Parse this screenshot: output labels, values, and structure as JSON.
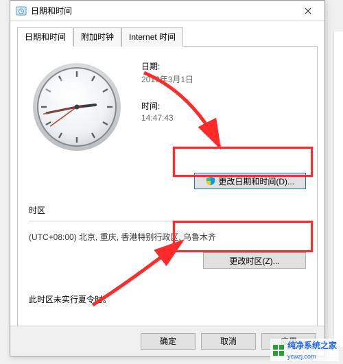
{
  "dialog": {
    "title": "日期和时间",
    "tabs": [
      {
        "label": "日期和时间"
      },
      {
        "label": "附加时钟"
      },
      {
        "label": "Internet 时间"
      }
    ],
    "dateLabel": "日期:",
    "dateValue": "2019年3月1日",
    "timeLabel": "时间:",
    "timeValue": "14:47:43",
    "changeDateTimeBtn": "更改日期和时间(D)...",
    "tzSectionLabel": "时区",
    "tzValue": "(UTC+08:00) 北京, 重庆, 香港特别行政区, 乌鲁木齐",
    "changeTzBtn": "更改时区(Z)...",
    "dstNote": "此时区未实行夏令时。",
    "okBtn": "确定",
    "cancelBtn": "取消",
    "applyBtn": "应用"
  },
  "watermark": {
    "brand": "纯净系统之家",
    "url": "ycwzj.com"
  },
  "colors": {
    "highlight": "#ff2a2a",
    "focus": "#0078d7"
  }
}
